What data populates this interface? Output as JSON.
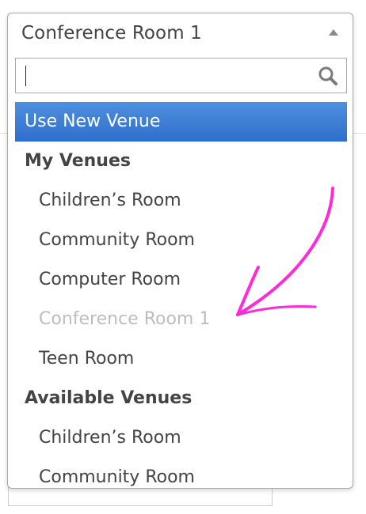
{
  "select": {
    "value": "Conference Room 1"
  },
  "search": {
    "value": "",
    "placeholder": ""
  },
  "options": {
    "use_new": "Use New Venue",
    "my_venues_label": "My Venues",
    "my_venues": [
      "Children’s Room",
      "Community Room",
      "Computer Room",
      "Conference Room 1",
      "Teen Room"
    ],
    "available_label": "Available Venues",
    "available": [
      "Children’s Room",
      "Community Room"
    ]
  },
  "colors": {
    "highlight": "#2f6fcc",
    "annotation_arrow": "#ff2bd6",
    "disabled_text": "#bdbdbd"
  },
  "icons": {
    "search": "magnifier-icon",
    "dropdown": "triangle-up-icon",
    "annotation": "curved-arrow-icon"
  }
}
